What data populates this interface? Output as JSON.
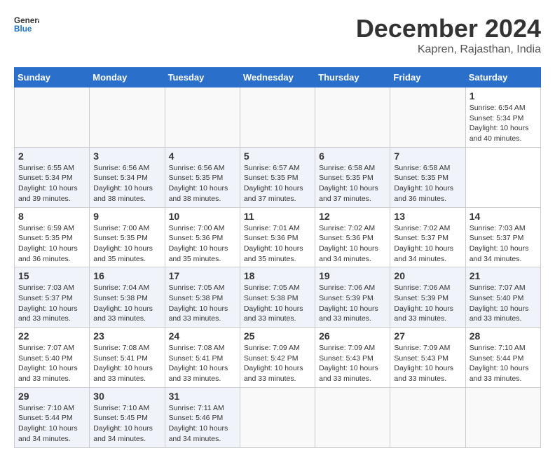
{
  "header": {
    "logo_text_general": "General",
    "logo_text_blue": "Blue",
    "title": "December 2024",
    "subtitle": "Kapren, Rajasthan, India"
  },
  "calendar": {
    "days_of_week": [
      "Sunday",
      "Monday",
      "Tuesday",
      "Wednesday",
      "Thursday",
      "Friday",
      "Saturday"
    ],
    "weeks": [
      [
        {
          "day": "",
          "info": ""
        },
        {
          "day": "",
          "info": ""
        },
        {
          "day": "",
          "info": ""
        },
        {
          "day": "",
          "info": ""
        },
        {
          "day": "",
          "info": ""
        },
        {
          "day": "",
          "info": ""
        },
        {
          "day": "1",
          "info": "Sunrise: 6:54 AM\nSunset: 5:34 PM\nDaylight: 10 hours\nand 40 minutes."
        }
      ],
      [
        {
          "day": "2",
          "info": "Sunrise: 6:55 AM\nSunset: 5:34 PM\nDaylight: 10 hours\nand 39 minutes."
        },
        {
          "day": "3",
          "info": "Sunrise: 6:56 AM\nSunset: 5:34 PM\nDaylight: 10 hours\nand 38 minutes."
        },
        {
          "day": "4",
          "info": "Sunrise: 6:56 AM\nSunset: 5:35 PM\nDaylight: 10 hours\nand 38 minutes."
        },
        {
          "day": "5",
          "info": "Sunrise: 6:57 AM\nSunset: 5:35 PM\nDaylight: 10 hours\nand 37 minutes."
        },
        {
          "day": "6",
          "info": "Sunrise: 6:58 AM\nSunset: 5:35 PM\nDaylight: 10 hours\nand 37 minutes."
        },
        {
          "day": "7",
          "info": "Sunrise: 6:58 AM\nSunset: 5:35 PM\nDaylight: 10 hours\nand 36 minutes."
        }
      ],
      [
        {
          "day": "8",
          "info": "Sunrise: 6:59 AM\nSunset: 5:35 PM\nDaylight: 10 hours\nand 36 minutes."
        },
        {
          "day": "9",
          "info": "Sunrise: 7:00 AM\nSunset: 5:35 PM\nDaylight: 10 hours\nand 35 minutes."
        },
        {
          "day": "10",
          "info": "Sunrise: 7:00 AM\nSunset: 5:36 PM\nDaylight: 10 hours\nand 35 minutes."
        },
        {
          "day": "11",
          "info": "Sunrise: 7:01 AM\nSunset: 5:36 PM\nDaylight: 10 hours\nand 35 minutes."
        },
        {
          "day": "12",
          "info": "Sunrise: 7:02 AM\nSunset: 5:36 PM\nDaylight: 10 hours\nand 34 minutes."
        },
        {
          "day": "13",
          "info": "Sunrise: 7:02 AM\nSunset: 5:37 PM\nDaylight: 10 hours\nand 34 minutes."
        },
        {
          "day": "14",
          "info": "Sunrise: 7:03 AM\nSunset: 5:37 PM\nDaylight: 10 hours\nand 34 minutes."
        }
      ],
      [
        {
          "day": "15",
          "info": "Sunrise: 7:03 AM\nSunset: 5:37 PM\nDaylight: 10 hours\nand 33 minutes."
        },
        {
          "day": "16",
          "info": "Sunrise: 7:04 AM\nSunset: 5:38 PM\nDaylight: 10 hours\nand 33 minutes."
        },
        {
          "day": "17",
          "info": "Sunrise: 7:05 AM\nSunset: 5:38 PM\nDaylight: 10 hours\nand 33 minutes."
        },
        {
          "day": "18",
          "info": "Sunrise: 7:05 AM\nSunset: 5:38 PM\nDaylight: 10 hours\nand 33 minutes."
        },
        {
          "day": "19",
          "info": "Sunrise: 7:06 AM\nSunset: 5:39 PM\nDaylight: 10 hours\nand 33 minutes."
        },
        {
          "day": "20",
          "info": "Sunrise: 7:06 AM\nSunset: 5:39 PM\nDaylight: 10 hours\nand 33 minutes."
        },
        {
          "day": "21",
          "info": "Sunrise: 7:07 AM\nSunset: 5:40 PM\nDaylight: 10 hours\nand 33 minutes."
        }
      ],
      [
        {
          "day": "22",
          "info": "Sunrise: 7:07 AM\nSunset: 5:40 PM\nDaylight: 10 hours\nand 33 minutes."
        },
        {
          "day": "23",
          "info": "Sunrise: 7:08 AM\nSunset: 5:41 PM\nDaylight: 10 hours\nand 33 minutes."
        },
        {
          "day": "24",
          "info": "Sunrise: 7:08 AM\nSunset: 5:41 PM\nDaylight: 10 hours\nand 33 minutes."
        },
        {
          "day": "25",
          "info": "Sunrise: 7:09 AM\nSunset: 5:42 PM\nDaylight: 10 hours\nand 33 minutes."
        },
        {
          "day": "26",
          "info": "Sunrise: 7:09 AM\nSunset: 5:43 PM\nDaylight: 10 hours\nand 33 minutes."
        },
        {
          "day": "27",
          "info": "Sunrise: 7:09 AM\nSunset: 5:43 PM\nDaylight: 10 hours\nand 33 minutes."
        },
        {
          "day": "28",
          "info": "Sunrise: 7:10 AM\nSunset: 5:44 PM\nDaylight: 10 hours\nand 33 minutes."
        }
      ],
      [
        {
          "day": "29",
          "info": "Sunrise: 7:10 AM\nSunset: 5:44 PM\nDaylight: 10 hours\nand 34 minutes."
        },
        {
          "day": "30",
          "info": "Sunrise: 7:10 AM\nSunset: 5:45 PM\nDaylight: 10 hours\nand 34 minutes."
        },
        {
          "day": "31",
          "info": "Sunrise: 7:11 AM\nSunset: 5:46 PM\nDaylight: 10 hours\nand 34 minutes."
        },
        {
          "day": "",
          "info": ""
        },
        {
          "day": "",
          "info": ""
        },
        {
          "day": "",
          "info": ""
        },
        {
          "day": "",
          "info": ""
        }
      ]
    ]
  }
}
